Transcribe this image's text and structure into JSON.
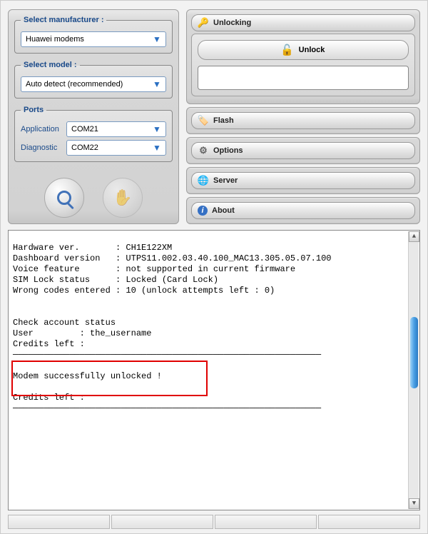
{
  "left": {
    "manufacturer_legend": "Select manufacturer :",
    "manufacturer_value": "Huawei modems",
    "model_legend": "Select model :",
    "model_value": "Auto detect (recommended)",
    "ports_legend": "Ports",
    "port_app_label": "Application",
    "port_app_value": "COM21",
    "port_diag_label": "Diagnostic",
    "port_diag_value": "COM22"
  },
  "panels": {
    "unlocking": "Unlocking",
    "unlock_btn": "Unlock",
    "flash": "Flash",
    "options": "Options",
    "server": "Server",
    "about": "About"
  },
  "log_text": "Hardware ver.       : CH1E122XM\nDashboard version   : UTPS11.002.03.40.100_MAC13.305.05.07.100\nVoice feature       : not supported in current firmware\nSIM Lock status     : Locked (Card Lock)\nWrong codes entered : 10 (unlock attempts left : 0)\n\n\nCheck account status\nUser         : the_username\nCredits left :\n────────────────────────────────────────────────────────────\n\nModem successfully unlocked !\n\nCredits left :\n────────────────────────────────────────────────────────────\n"
}
